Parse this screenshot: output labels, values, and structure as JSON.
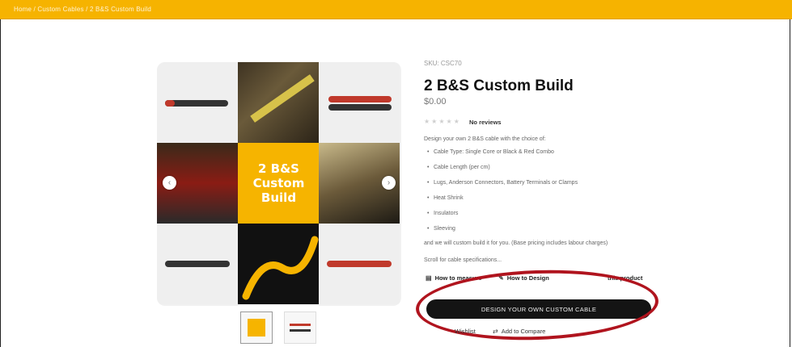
{
  "breadcrumb": "Home / Custom Cables / 2 B&S Custom Build",
  "gallery": {
    "title_lines": [
      "2 B&S",
      "Custom",
      "Build"
    ],
    "prev_icon": "chevron-left-icon",
    "next_icon": "chevron-right-icon",
    "prev_glyph": "‹",
    "next_glyph": "›"
  },
  "product": {
    "sku": "SKU: CSC70",
    "title": "2 B&S Custom Build",
    "price": "$0.00",
    "stars": "★★★★★",
    "reviews": "No reviews",
    "description": "Design your own 2 B&S cable with the choice of:",
    "bullets": [
      "Cable Type: Single Core or Black & Red Combo",
      "Cable Length (per cm)",
      "Lugs, Anderson Connectors, Battery Terminals or Clamps",
      "Heat Shrink",
      "Insulators",
      "Sleeving"
    ],
    "closing": "and we will custom build it for you. (Base pricing includes labour charges)",
    "scroll_note": "Scroll for cable specifications..."
  },
  "links": {
    "how_to_measure": "How to measure",
    "how_to_design": "How to Design",
    "share": "this product"
  },
  "cta": {
    "label": "DESIGN YOUR OWN CUSTOM CABLE"
  },
  "footer": {
    "wishlist": "Wishlist",
    "compare": "Add to Compare"
  }
}
